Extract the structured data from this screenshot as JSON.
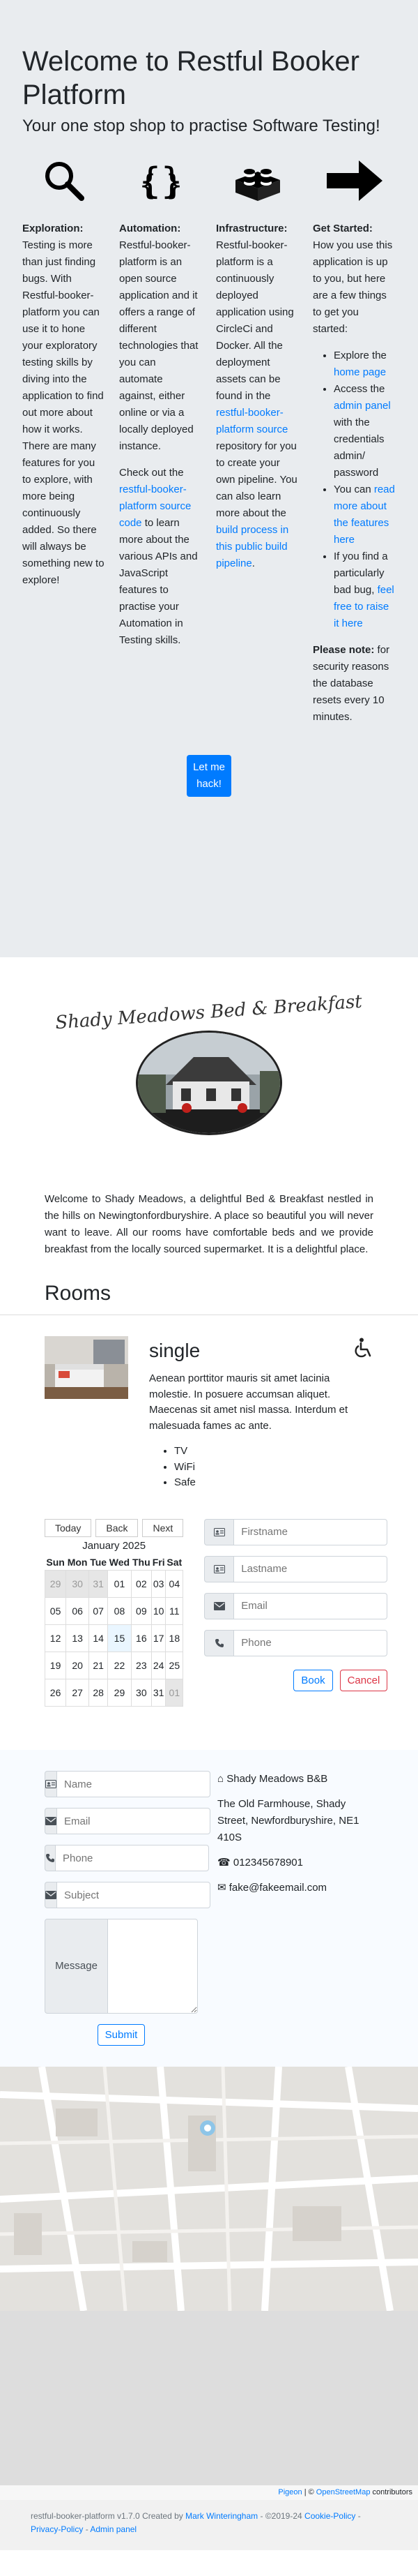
{
  "hero": {
    "title": "Welcome to Restful Booker Platform",
    "subtitle": "Your one stop shop to practise Software Testing!",
    "exploration": {
      "heading": "Exploration:",
      "text": "Testing is more than just finding bugs. With Restful-booker-platform you can use it to hone your exploratory testing skills by diving into the application to find out more about how it works. There are many features for you to explore, with more being continuously added. So there will always be something new to explore!"
    },
    "automation": {
      "heading": "Automation:",
      "text": "Restful-booker-platform is an open source application and it offers a range of different technologies that you can automate against, either online or via a locally deployed instance.",
      "text2_pre": "Check out the",
      "text2_link": "restful-booker-platform source code",
      "text2_post": "to learn more about the various APIs and JavaScript features to practise your Automation in Testing skills."
    },
    "infrastructure": {
      "heading": "Infrastructure:",
      "text_pre": "Restful-booker-platform is a continuously deployed application using CircleCi and Docker. All the deployment assets can be found in the",
      "text_link": "restful-booker-platform source",
      "text_mid": "repository for you to create your own pipeline. You can also learn more about the",
      "text_link2": "build process in this public build pipeline",
      "text_post": "."
    },
    "get_started": {
      "heading": "Get Started:",
      "text": "How you use this application is up to you, but here are a few things to get you started:",
      "items": [
        {
          "pre": "Explore the",
          "link": "home page",
          "post": ""
        },
        {
          "pre": "Access the",
          "link": "admin panel",
          "post": "with the credentials admin/ password"
        },
        {
          "pre": "You can",
          "link": "read more about the features here",
          "post": ""
        },
        {
          "pre": "If you find a particularly bad bug,",
          "link": "feel free to raise it here",
          "post": ""
        }
      ],
      "note_heading": "Please note:",
      "note_text": "for security reasons the database resets every 10 minutes."
    },
    "hack_button": "Let me hack!"
  },
  "hotel": {
    "logo_text": "Shady Meadows Bed & Breakfast",
    "description": "Welcome to Shady Meadows, a delightful Bed & Breakfast nestled in the hills on Newingtonfordburyshire. A place so beautiful you will never want to leave. All our rooms have comfortable beds and we provide breakfast from the locally sourced supermarket. It is a delightful place."
  },
  "rooms": {
    "title": "Rooms",
    "room": {
      "type": "single",
      "description": "Aenean porttitor mauris sit amet lacinia molestie. In posuere accumsan aliquet. Maecenas sit amet nisl massa. Interdum et malesuada fames ac ante.",
      "features": [
        "TV",
        "WiFi",
        "Safe"
      ]
    }
  },
  "calendar": {
    "today": "Today",
    "back": "Back",
    "next": "Next",
    "month_label": "January 2025",
    "weekdays": [
      "Sun",
      "Mon",
      "Tue",
      "Wed",
      "Thu",
      "Fri",
      "Sat"
    ],
    "weeks": [
      [
        {
          "d": "29",
          "off": true
        },
        {
          "d": "30",
          "off": true
        },
        {
          "d": "31",
          "off": true
        },
        {
          "d": "01"
        },
        {
          "d": "02"
        },
        {
          "d": "03"
        },
        {
          "d": "04"
        }
      ],
      [
        {
          "d": "05"
        },
        {
          "d": "06"
        },
        {
          "d": "07"
        },
        {
          "d": "08"
        },
        {
          "d": "09"
        },
        {
          "d": "10"
        },
        {
          "d": "11"
        }
      ],
      [
        {
          "d": "12"
        },
        {
          "d": "13"
        },
        {
          "d": "14"
        },
        {
          "d": "15",
          "today": true
        },
        {
          "d": "16"
        },
        {
          "d": "17"
        },
        {
          "d": "18"
        }
      ],
      [
        {
          "d": "19"
        },
        {
          "d": "20"
        },
        {
          "d": "21"
        },
        {
          "d": "22"
        },
        {
          "d": "23"
        },
        {
          "d": "24"
        },
        {
          "d": "25"
        }
      ],
      [
        {
          "d": "26"
        },
        {
          "d": "27"
        },
        {
          "d": "28"
        },
        {
          "d": "29"
        },
        {
          "d": "30"
        },
        {
          "d": "31"
        },
        {
          "d": "01",
          "off": true
        }
      ]
    ]
  },
  "booking": {
    "firstname_placeholder": "Firstname",
    "lastname_placeholder": "Lastname",
    "email_placeholder": "Email",
    "phone_placeholder": "Phone",
    "book_button": "Book",
    "cancel_button": "Cancel"
  },
  "contact": {
    "name_placeholder": "Name",
    "email_placeholder": "Email",
    "phone_placeholder": "Phone",
    "subject_placeholder": "Subject",
    "message_label": "Message",
    "submit": "Submit",
    "business_name": "Shady Meadows B&B",
    "address": "The Old Farmhouse, Shady Street, Newfordburyshire, NE1 410S",
    "phone": "012345678901",
    "email": "fake@fakeemail.com"
  },
  "map": {
    "attribution_pigeon": "Pigeon",
    "attribution_sep": "|",
    "attribution_prefix": "©",
    "attribution_osm": "OpenStreetMap",
    "attribution_suffix": "contributors"
  },
  "footer": {
    "text": "restful-booker-platform v1.7.0 Created by",
    "author": "Mark Winteringham",
    "years": "- ©2019-24",
    "cookie": "Cookie-Policy",
    "sep1": "-",
    "privacy": "Privacy-Policy",
    "sep2": "-",
    "admin": "Admin panel"
  }
}
